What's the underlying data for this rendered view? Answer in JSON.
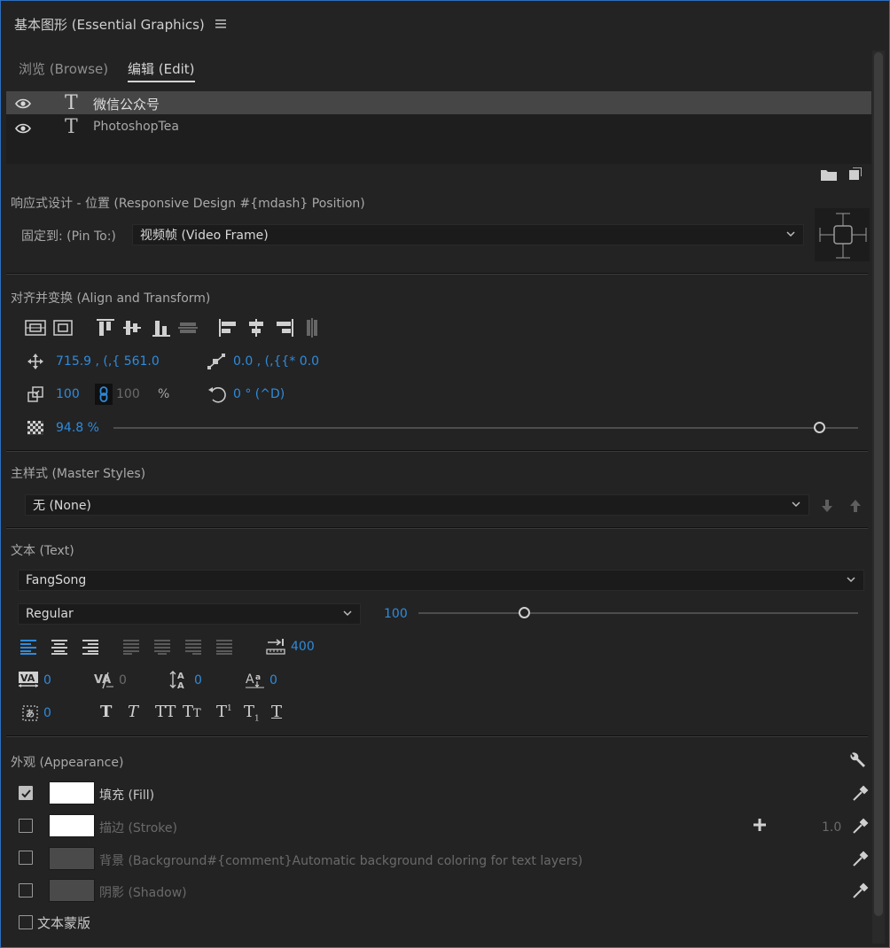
{
  "panel": {
    "title": "基本图形 (Essential Graphics)",
    "menu_icon": "hamburger-icon"
  },
  "tabs": [
    {
      "label": "浏览 (Browse)",
      "active": false
    },
    {
      "label": "编辑 (Edit)",
      "active": true
    }
  ],
  "layers": [
    {
      "name": "微信公众号",
      "type": "text-layer-icon",
      "visible": true,
      "selected": true
    },
    {
      "name": "PhotoshopTea",
      "type": "text-layer-icon",
      "visible": true,
      "selected": false
    }
  ],
  "responsive": {
    "title": "响应式设计 - 位置 (Responsive Design #{mdash} Position)",
    "pin_label": "固定到: (Pin To:)",
    "pin_value": "视频帧 (Video Frame)"
  },
  "align": {
    "title": "对齐并变换 (Align and Transform)",
    "position": "715.9 , (,{ 561.0",
    "anchor": "0.0 , (,{{* 0.0",
    "scale": "100",
    "scale_linked": "100",
    "scale_unit": "%",
    "rotation": "0 ° (^D)",
    "opacity": "94.8 %",
    "opacity_fraction": 0.948
  },
  "master_styles": {
    "title": "主样式 (Master Styles)",
    "value": "无 (None)"
  },
  "text": {
    "title": "文本 (Text)",
    "font": "FangSong",
    "style": "Regular",
    "size": "100",
    "size_fraction": 0.24,
    "tab_width": "400",
    "tracking": "0",
    "kerning": "0",
    "leading": "0",
    "baseline": "0",
    "tsume": "0"
  },
  "appearance": {
    "title": "外观 (Appearance)",
    "fill_label": "填充 (Fill)",
    "fill_checked": true,
    "fill_color": "#ffffff",
    "stroke_label": "描边 (Stroke)",
    "stroke_checked": false,
    "stroke_color": "#ffffff",
    "stroke_width": "1.0",
    "background_label": "背景 (Background#{comment}Automatic background coloring for text layers)",
    "background_checked": false,
    "background_color": "#4a4a4a",
    "shadow_label": "阴影 (Shadow)",
    "shadow_checked": false,
    "shadow_color": "#4a4a4a",
    "mask_label": "文本蒙版",
    "mask_checked": false
  },
  "colors": {
    "accent": "#2f8bdb",
    "panel_bg": "#232323",
    "selected_row": "#464646"
  }
}
